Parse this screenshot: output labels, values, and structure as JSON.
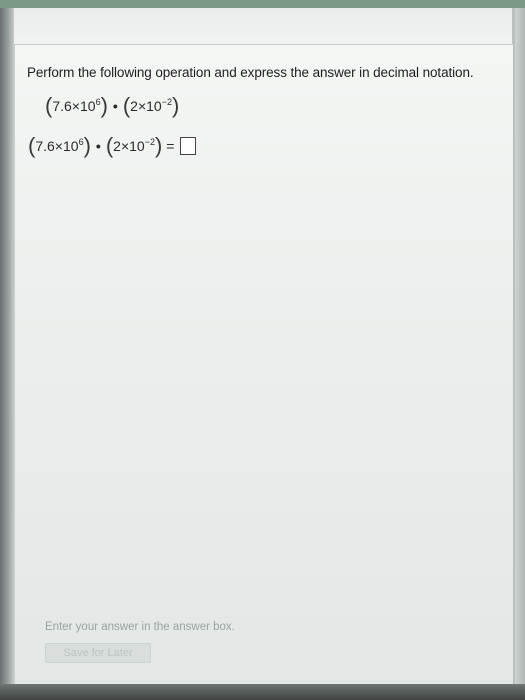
{
  "question": {
    "prompt": "Perform the following operation and express the answer in decimal notation.",
    "expression": {
      "term1_coef": "7.6",
      "term1_base": "10",
      "term1_exp": "6",
      "term2_coef": "2",
      "term2_base": "10",
      "term2_exp": "−2",
      "times": "×",
      "dot": "•",
      "equals": "="
    }
  },
  "footer": {
    "instruction": "Enter your answer in the answer box.",
    "save_label": "Save for Later"
  }
}
